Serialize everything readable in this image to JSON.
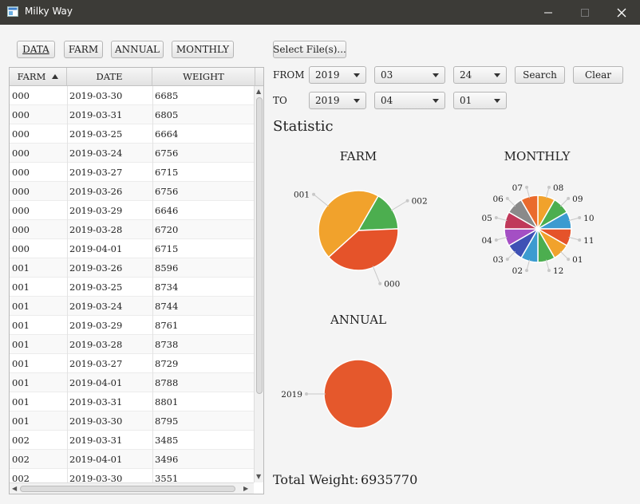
{
  "window": {
    "title": "Milky Way"
  },
  "nav": {
    "data": "DATA",
    "farm": "FARM",
    "annual": "ANNUAL",
    "monthly": "MONTHLY",
    "select_files": "Select File(s)..."
  },
  "filter": {
    "from_label": "FROM",
    "to_label": "TO",
    "from_year": "2019",
    "from_month": "03",
    "from_day": "24",
    "to_year": "2019",
    "to_month": "04",
    "to_day": "01",
    "search": "Search",
    "clear": "Clear"
  },
  "table": {
    "columns": [
      "FARM",
      "DATE",
      "WEIGHT"
    ],
    "rows": [
      [
        "000",
        "2019-03-30",
        "6685"
      ],
      [
        "000",
        "2019-03-31",
        "6805"
      ],
      [
        "000",
        "2019-03-25",
        "6664"
      ],
      [
        "000",
        "2019-03-24",
        "6756"
      ],
      [
        "000",
        "2019-03-27",
        "6715"
      ],
      [
        "000",
        "2019-03-26",
        "6756"
      ],
      [
        "000",
        "2019-03-29",
        "6646"
      ],
      [
        "000",
        "2019-03-28",
        "6720"
      ],
      [
        "000",
        "2019-04-01",
        "6715"
      ],
      [
        "001",
        "2019-03-26",
        "8596"
      ],
      [
        "001",
        "2019-03-25",
        "8734"
      ],
      [
        "001",
        "2019-03-24",
        "8744"
      ],
      [
        "001",
        "2019-03-29",
        "8761"
      ],
      [
        "001",
        "2019-03-28",
        "8738"
      ],
      [
        "001",
        "2019-03-27",
        "8729"
      ],
      [
        "001",
        "2019-04-01",
        "8788"
      ],
      [
        "001",
        "2019-03-31",
        "8801"
      ],
      [
        "001",
        "2019-03-30",
        "8795"
      ],
      [
        "002",
        "2019-03-31",
        "3485"
      ],
      [
        "002",
        "2019-04-01",
        "3496"
      ],
      [
        "002",
        "2019-03-30",
        "3551"
      ]
    ]
  },
  "statistic": {
    "heading": "Statistic",
    "total_label": "Total Weight:",
    "total_value": "6935770"
  },
  "chart_data": [
    {
      "type": "pie",
      "title": "FARM",
      "categories": [
        "002",
        "000",
        "001"
      ],
      "values": [
        16,
        39,
        45
      ],
      "colors": [
        "#4cae4f",
        "#e5532a",
        "#f1a22c"
      ]
    },
    {
      "type": "pie",
      "title": "MONTHLY",
      "categories": [
        "08",
        "09",
        "10",
        "11",
        "01",
        "12",
        "02",
        "03",
        "04",
        "05",
        "06",
        "07"
      ],
      "values": [
        1,
        1,
        1,
        1,
        1,
        1,
        1,
        1,
        1,
        1,
        1,
        1
      ],
      "colors": [
        "#f1a22c",
        "#4cae4f",
        "#3c9bd0",
        "#e5532a",
        "#f1a22c",
        "#4cae4f",
        "#3c9bd0",
        "#3f51b5",
        "#a44fc4",
        "#c0395a",
        "#8a8a8a",
        "#ea6a2c"
      ]
    },
    {
      "type": "pie",
      "title": "ANNUAL",
      "categories": [
        "2019"
      ],
      "values": [
        100
      ],
      "colors": [
        "#e5582c"
      ]
    }
  ]
}
